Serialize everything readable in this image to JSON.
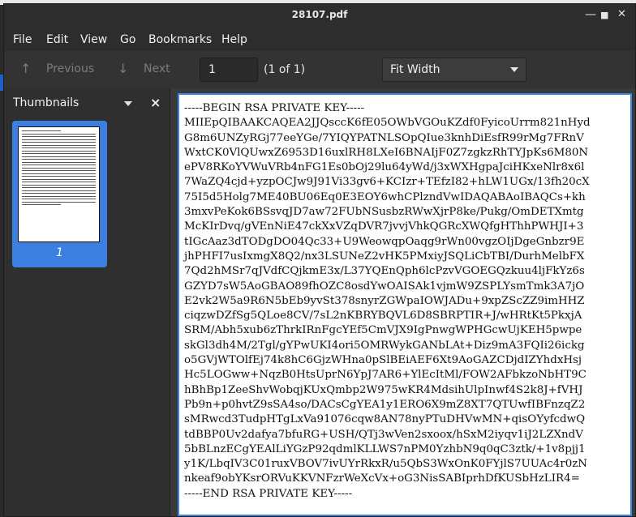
{
  "window": {
    "title": "28107.pdf",
    "controls": {
      "minimize": "—",
      "maximize": "■",
      "close": "✕"
    }
  },
  "menubar": {
    "items": [
      "File",
      "Edit",
      "View",
      "Go",
      "Bookmarks",
      "Help"
    ]
  },
  "toolbar": {
    "previous_label": "Previous",
    "next_label": "Next",
    "page_value": "1",
    "page_count": "(1 of 1)",
    "zoom_value": "Fit Width"
  },
  "sidebar": {
    "title": "Thumbnails",
    "close_label": "×",
    "thumbnail_label": "1"
  },
  "document": {
    "lines": [
      "-----BEGIN RSA PRIVATE KEY-----",
      "MIIEpQIBAAKCAQEA2JJQsccK6fE05OWbVGOuKZdf0FyicoUrrm821nHyd",
      "G8m6UNZyRGj77eeYGe/7YIQYPATNLSOpQIue3knhDiEsfR99rMg7FRnV",
      "WxtCK0VlQUwxZ6953D16uxlRH8LXeI6BNAIjF0Z7zgkzRhTYJpKs6M80N",
      "ePV8RKoYVWuVRb4nFG1Es0bOj29lu64yWd/j3xWXHgpaJciHKxeNlr8x6l",
      "7WaZQ4cjd+yzpOCJw9J91Vi33gv6+KCIzr+TEfzI82+hLW1UGx/13fh20cX",
      "75I5d5Holg7ME40BU06Eq0E3EOY6whCPlzndVwIDAQABAoIBAQCs+kh",
      "3mxvPeKok6BSsvqJD7aw72FUbNSusbzRWwXjrP8ke/Pukg/OmDETXmtg",
      "McKIrDvq/gVEnNiE47ckXxVZqDVR7jvvjVhkQGRcXWQfgHThhPWHJI+3",
      "tIGcAaz3dTODgDO04Qc33+U9WeowqpOaqg9rWn00vgzOIjDgeGnbzr9E",
      "jhPHFI7usIxmgX8Q2/nx3LSUNeZ2vHK5PMxiyJSQLiCbTBI/DurhMelbFX",
      "7Qd2hMSr7qJVdfCQjkmE3x/L37YQEnQph6lcPzvVGOEGQzkuu4ljFkYz6s",
      "GZYD7sW5AoGBAO89fhOZC8osdYwOAISAk1vjmW9ZSPLYsmTmk3A7jO",
      "E2vk2W5a9R6N5bEb9yvSt378snyrZGWpaIOWJADu+9xpZScZZ9imHHZ",
      "ciqzwDZfSg5QLoe8CV/7sL2nKBRYBQVL6D8SBRPTIR+J/wHRtKt5PkxjA",
      "SRM/Abh5xub6zThrkIRnFgcYEf5CmVJX9IgPnwgWPHGcwUjKEH5pwpe",
      "skGl3dh4M/2Tgl/gYPwUKI4ori5OMRWykGANbLAt+Diz9mA3FQIi26ickg",
      "o5GVjWTOlfEj74k8hC6GjzWHna0pSlBEiAEF6Xt9AoGAZCDjdIZYhdxHsj",
      "Hc5LOGww+NqzB0HtsUprN6YpJ7AR6+YlEcItMl/FOW2AFbkzoNbHT9C",
      "hBhBp1ZeeShvWobqjKUxQmbp2W975wKR4MdsihUlpInwf4S2k8J+fVHJ",
      "Pb9n+p0hvtZ9sSA4so/DACsCgYEA1y1ERO6X9mZ8XT7QTUwfIBFnzqZ2",
      "sMRwcd3TudpHTgLxVa91076cqw8AN78nyPTuDHVwMN+qisOYyfcdwQ",
      "tdBBP0Uv2dafya7bfuRG+USH/QTj3wVen2sxoox/hSxM2iyqv1iJ2LZXndV",
      "5bBLnzECgYEAlLiYGzP92qdmlKLLWS7nPM0YzhbN9q0qC3ztk/+1v8pjj1",
      "y1K/LbqIV3C01ruxVBOV7ivUYrRkxR/u5QbS3WxOnK0FYjlS7UUAc4r0zN",
      "nkeaf9obYKsrORVuKKVNFzrWeXcVx+oG3NisSABIprhDfKUSbHzLIR4=",
      "-----END RSA PRIVATE KEY-----"
    ]
  }
}
